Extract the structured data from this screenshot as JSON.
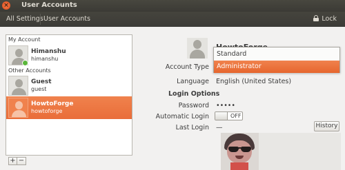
{
  "window": {
    "title": "User Accounts"
  },
  "toolbar": {
    "all_settings": "All Settings",
    "user_accounts": "User Accounts",
    "lock_label": "Lock"
  },
  "user_list": {
    "my_account_label": "My Account",
    "other_accounts_label": "Other Accounts",
    "users": [
      {
        "name": "Himanshu",
        "login": "himanshu"
      },
      {
        "name": "Guest",
        "login": "guest"
      },
      {
        "name": "HowtoForge",
        "login": "howtoforge"
      }
    ],
    "add_label": "+",
    "remove_label": "−"
  },
  "details": {
    "full_name": "HowtoForge",
    "account_type_label": "Account Type",
    "language_label": "Language",
    "language_value": "English (United States)",
    "login_options_title": "Login Options",
    "password_label": "Password",
    "password_value": "•••••",
    "automatic_login_label": "Automatic Login",
    "automatic_login_state": "OFF",
    "last_login_label": "Last Login",
    "last_login_value": "—",
    "history_button": "History"
  },
  "account_type_dropdown": {
    "options": [
      "Standard",
      "Administrator"
    ],
    "highlighted": "Administrator"
  },
  "colors": {
    "accent": "#e96d39",
    "titlebar": "#3c3b37",
    "online": "#5bb73b"
  }
}
